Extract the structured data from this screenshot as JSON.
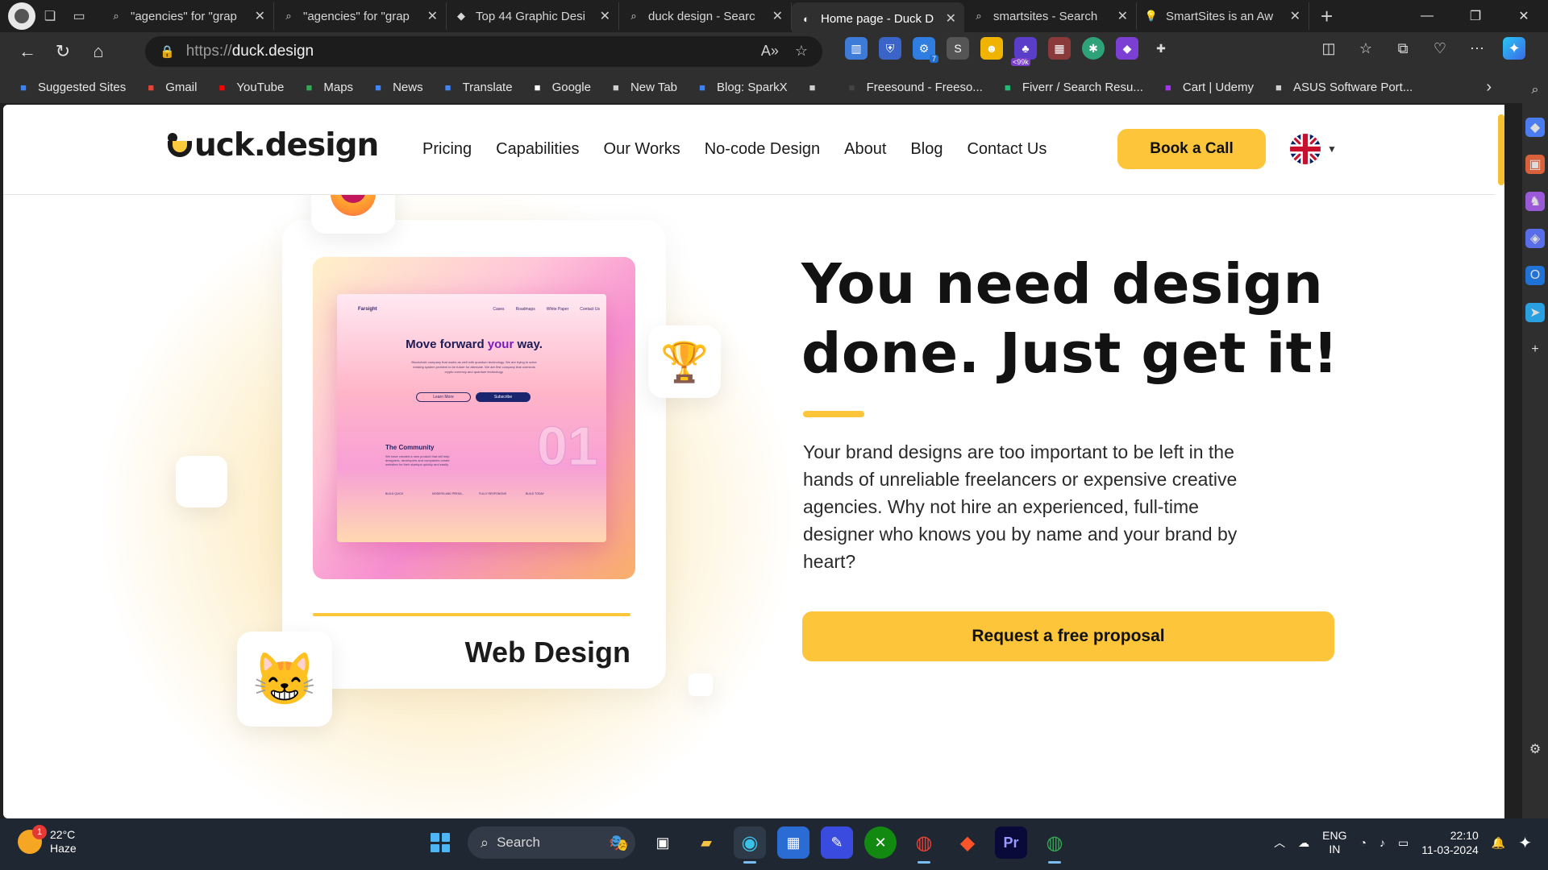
{
  "browser": {
    "tabs": [
      {
        "title": "\"agencies\" for \"grap",
        "icon": "search-icon"
      },
      {
        "title": "\"agencies\" for \"grap",
        "icon": "search-icon"
      },
      {
        "title": "Top 44 Graphic Desi",
        "icon": "brand-icon"
      },
      {
        "title": "duck design - Searc",
        "icon": "search-icon"
      },
      {
        "title": "Home page - Duck D",
        "icon": "duck-icon",
        "active": true
      },
      {
        "title": "smartsites - Search",
        "icon": "search-icon"
      },
      {
        "title": "SmartSites is an Aw",
        "icon": "bulb-icon"
      }
    ],
    "url_scheme": "https://",
    "url_host": "duck.design",
    "extension_badge_count": "7",
    "extension_badge_text": "<99k",
    "favorites": [
      {
        "label": "Suggested Sites",
        "color": "#3b82f6"
      },
      {
        "label": "Gmail",
        "color": "#ea4335"
      },
      {
        "label": "YouTube",
        "color": "#ff0000"
      },
      {
        "label": "Maps",
        "color": "#34a853"
      },
      {
        "label": "News",
        "color": "#4285f4"
      },
      {
        "label": "Translate",
        "color": "#4285f4"
      },
      {
        "label": "Google",
        "color": "#ffffff"
      },
      {
        "label": "New Tab",
        "color": "#cfcfcf"
      },
      {
        "label": "Blog: SparkX",
        "color": "#3b82f6"
      },
      {
        "label": "",
        "color": "#cfcfcf"
      },
      {
        "label": "Freesound - Freeso...",
        "color": "#444444"
      },
      {
        "label": "Fiverr / Search Resu...",
        "color": "#1dbf73"
      },
      {
        "label": "Cart | Udemy",
        "color": "#a435f0"
      },
      {
        "label": "ASUS Software Port...",
        "color": "#cfcfcf"
      }
    ]
  },
  "site": {
    "logo_text": "uck.design",
    "nav": [
      "Pricing",
      "Capabilities",
      "Our Works",
      "No-code Design",
      "About",
      "Blog",
      "Contact Us"
    ],
    "book_call": "Book a Call",
    "hero_title": "You need design done. Just get it!",
    "hero_text": "Your brand designs are too important to be left in the hands of unreliable freelancers or expensive creative agencies. Why not hire an experienced, full-time designer who knows you by name and your brand by heart?",
    "cta": "Request a free proposal",
    "card_label": "Web Design",
    "accent_color": "#fcc53a",
    "mockup": {
      "logo": "Farsight",
      "links": [
        "Cases",
        "Roadmaps",
        "White Paper",
        "Contact Us"
      ],
      "headline_a": "Move forward ",
      "headline_b": "your",
      "headline_c": " way.",
      "sub": "Blockchain company that works as well with quantum technology. We are trying to solve existing system problem to be future for alternate. We are first company that connects crypto currency and quantum technology.",
      "btn1": "Learn More",
      "btn2": "Subscribe",
      "community_title": "The Community",
      "community_text": "We have created a new product that will help designers, developers and companies create websites for their startups quickly and easily.",
      "cols": [
        "BUILD QUICK",
        "MODERN AND PRESA...",
        "FULLY RESPONSIVE",
        "BUILD TODAY"
      ],
      "number": "01"
    }
  },
  "taskbar": {
    "weather_temp": "22°C",
    "weather_desc": "Haze",
    "weather_badge": "1",
    "search_label": "Search",
    "lang_a": "ENG",
    "lang_b": "IN",
    "time": "22:10",
    "date": "11-03-2024"
  }
}
